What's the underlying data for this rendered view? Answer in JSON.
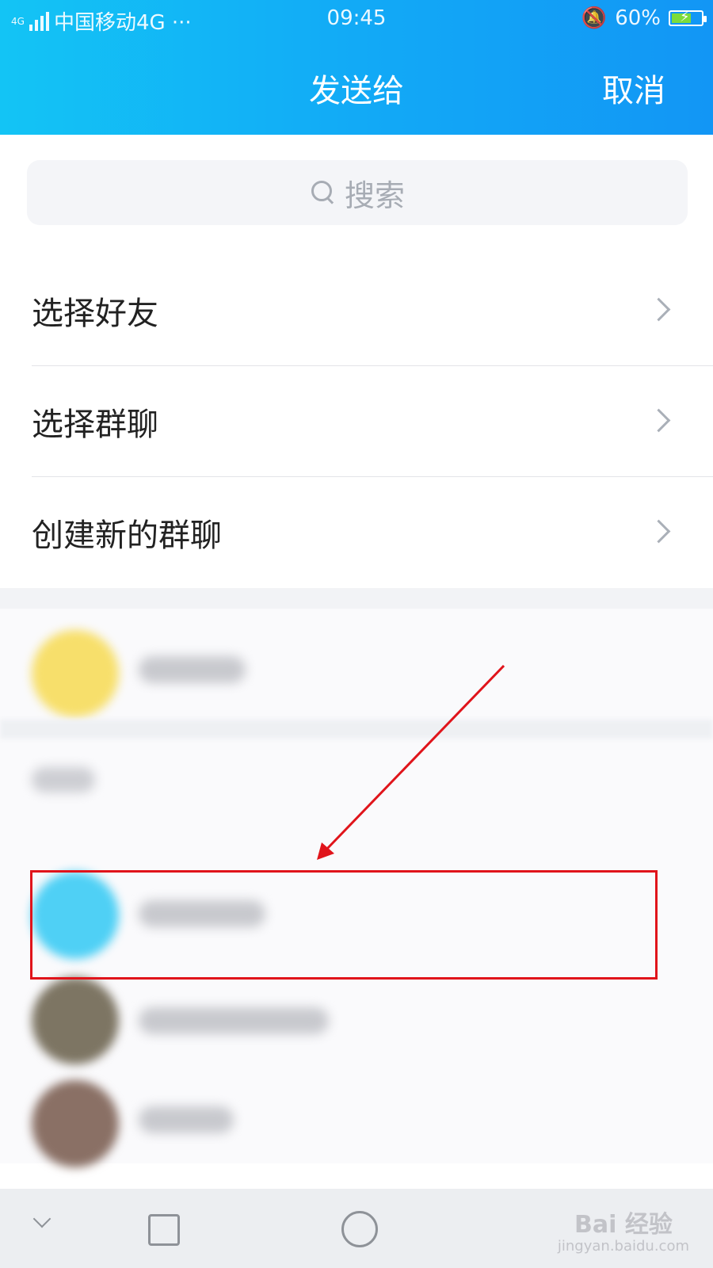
{
  "status_bar": {
    "left": "中国移动4G ···",
    "network_small": "4G",
    "time": "09:45",
    "battery": "60%"
  },
  "header": {
    "title": "发送给",
    "cancel_label": "取消",
    "gradient_colors": [
      "#13c4f5",
      "#1296f5"
    ]
  },
  "search": {
    "placeholder": "搜索"
  },
  "menu": {
    "items": [
      {
        "label": "选择好友"
      },
      {
        "label": "选择群聊"
      },
      {
        "label": "创建新的群聊"
      }
    ]
  },
  "contacts": {
    "avatar_colors": [
      "#f7df6b",
      "#4fd0f5",
      "#7d7563",
      "#8a7065"
    ]
  },
  "annotation": {
    "highlight_color": "#e0141b"
  },
  "watermark": {
    "brand": "Bai 经验",
    "url": "jingyan.baidu.com"
  }
}
